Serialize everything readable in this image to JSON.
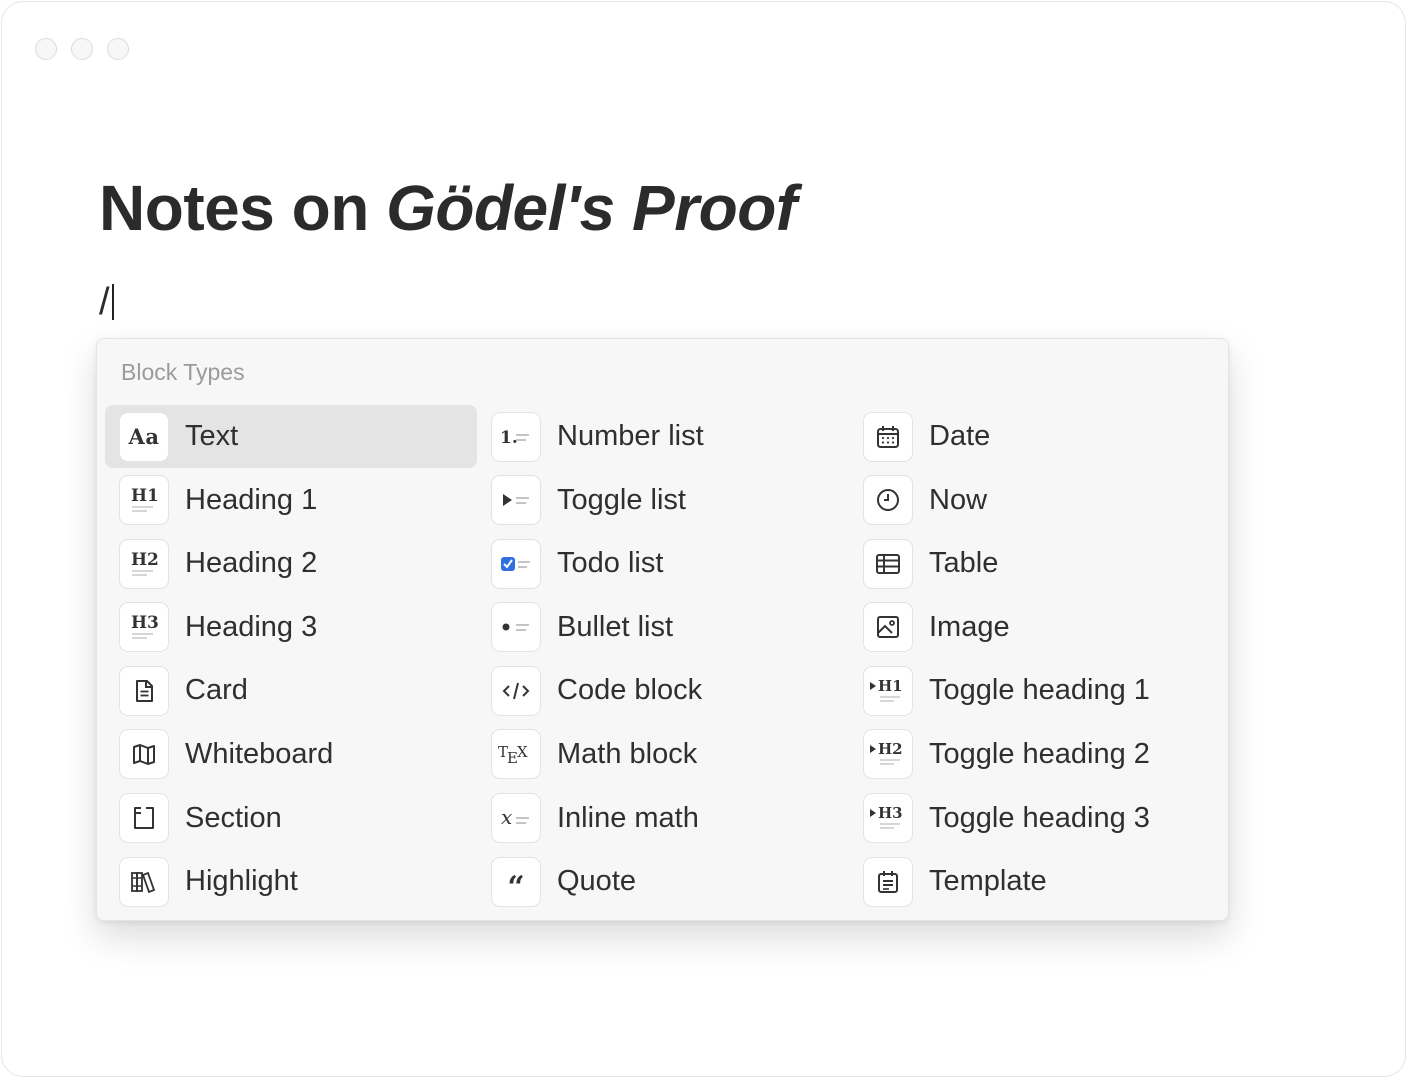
{
  "document": {
    "title_plain": "Notes on ",
    "title_italic": "Gödel's Proof",
    "editor_text": "/"
  },
  "menu": {
    "header": "Block Types",
    "selected_index": 0,
    "items": [
      {
        "label": "Text",
        "icon": "text-aa-icon"
      },
      {
        "label": "Number list",
        "icon": "number-list-icon"
      },
      {
        "label": "Date",
        "icon": "calendar-icon"
      },
      {
        "label": "Heading 1",
        "icon": "heading-1-icon"
      },
      {
        "label": "Toggle list",
        "icon": "toggle-list-icon"
      },
      {
        "label": "Now",
        "icon": "clock-icon"
      },
      {
        "label": "Heading 2",
        "icon": "heading-2-icon"
      },
      {
        "label": "Todo list",
        "icon": "todo-list-icon"
      },
      {
        "label": "Table",
        "icon": "table-icon"
      },
      {
        "label": "Heading 3",
        "icon": "heading-3-icon"
      },
      {
        "label": "Bullet list",
        "icon": "bullet-list-icon"
      },
      {
        "label": "Image",
        "icon": "image-icon"
      },
      {
        "label": "Card",
        "icon": "card-document-icon"
      },
      {
        "label": "Code block",
        "icon": "code-icon"
      },
      {
        "label": "Toggle heading 1",
        "icon": "toggle-heading-1-icon"
      },
      {
        "label": "Whiteboard",
        "icon": "whiteboard-map-icon"
      },
      {
        "label": "Math block",
        "icon": "tex-icon"
      },
      {
        "label": "Toggle heading 2",
        "icon": "toggle-heading-2-icon"
      },
      {
        "label": "Section",
        "icon": "section-icon"
      },
      {
        "label": "Inline math",
        "icon": "inline-math-icon"
      },
      {
        "label": "Toggle heading 3",
        "icon": "toggle-heading-3-icon"
      },
      {
        "label": "Highlight",
        "icon": "highlight-books-icon"
      },
      {
        "label": "Quote",
        "icon": "quote-icon"
      },
      {
        "label": "Template",
        "icon": "template-icon"
      }
    ]
  },
  "colors": {
    "checkbox_accent": "#2f6fe0",
    "selected_row": "#e4e4e4",
    "menu_background": "#f7f7f7"
  }
}
